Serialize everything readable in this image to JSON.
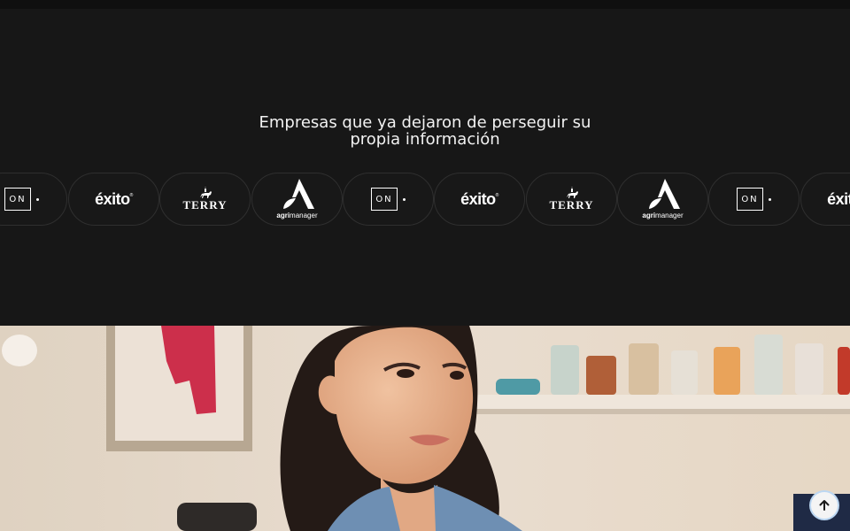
{
  "header": {
    "line1": "Empresas que ya dejaron de perseguir su",
    "line2": "propia información"
  },
  "logos": [
    {
      "type": "on",
      "text": "ON"
    },
    {
      "type": "exito",
      "text": "éxito"
    },
    {
      "type": "terry",
      "text": "TERRY"
    },
    {
      "type": "agri",
      "text_bold": "agri",
      "text_rest": "manager"
    },
    {
      "type": "on",
      "text": "ON"
    },
    {
      "type": "exito",
      "text": "éxito"
    },
    {
      "type": "terry",
      "text": "TERRY"
    },
    {
      "type": "agri",
      "text_bold": "agri",
      "text_rest": "manager"
    },
    {
      "type": "on",
      "text": "ON"
    },
    {
      "type": "exito",
      "text": "éxito"
    }
  ],
  "colors": {
    "background": "#171717",
    "pill_border": "#2f2f2f",
    "text": "#f2f2f2",
    "scroll_button": "#f4f4f4"
  },
  "icons": {
    "scroll_top": "arrow-up-icon"
  }
}
